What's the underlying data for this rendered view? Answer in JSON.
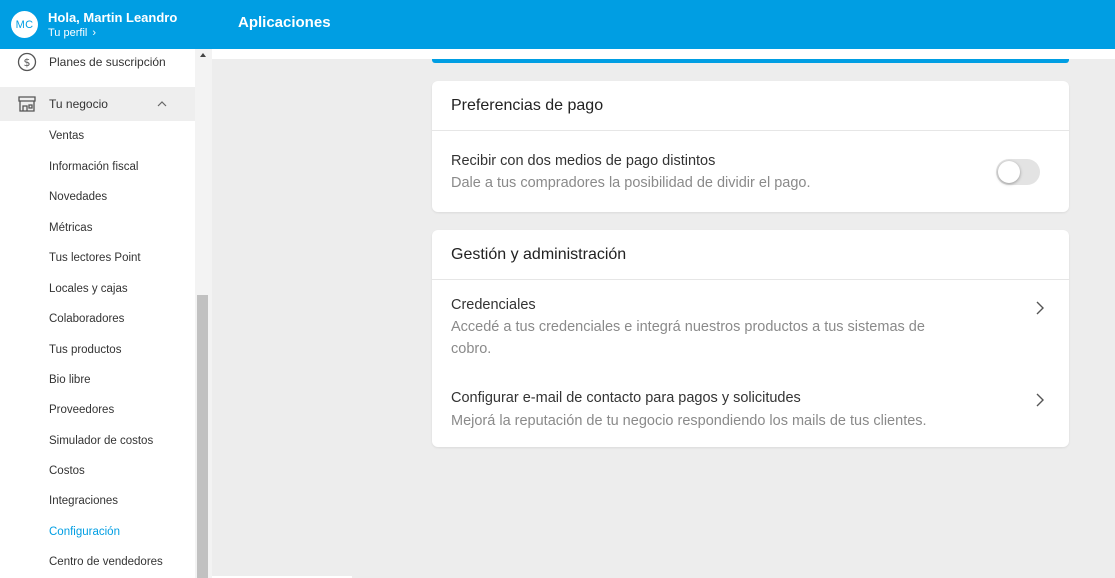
{
  "header": {
    "avatar_initials": "MC",
    "greeting": "Hola, Martin Leandro",
    "profile_link": "Tu perfil",
    "title": "Aplicaciones"
  },
  "sidebar": {
    "plan_label": "Planes de suscripción",
    "business_label": "Tu negocio",
    "sub_items": [
      "Ventas",
      "Información fiscal",
      "Novedades",
      "Métricas",
      "Tus lectores Point",
      "Locales y cajas",
      "Colaboradores",
      "Tus productos",
      "Bio libre",
      "Proveedores",
      "Simulador de costos",
      "Costos",
      "Integraciones",
      "Configuración",
      "Centro de vendedores"
    ],
    "active_item": "Configuración"
  },
  "payment_prefs": {
    "title": "Preferencias de pago",
    "option_title": "Recibir con dos medios de pago distintos",
    "option_desc": "Dale a tus compradores la posibilidad de dividir el pago.",
    "toggle_on": false
  },
  "management": {
    "title": "Gestión y administración",
    "items": [
      {
        "title": "Credenciales",
        "desc_line1": "Accedé a tus credenciales e integrá nuestros productos a tus sistemas de",
        "desc_line2": "cobro."
      },
      {
        "title": "Configurar e-mail de contacto para pagos y solicitudes",
        "desc_line1": "Mejorá la reputación de tu negocio respondiendo los mails de tus clientes."
      }
    ]
  },
  "colors": {
    "brand": "#009ee3",
    "active_text": "#009ee3"
  }
}
